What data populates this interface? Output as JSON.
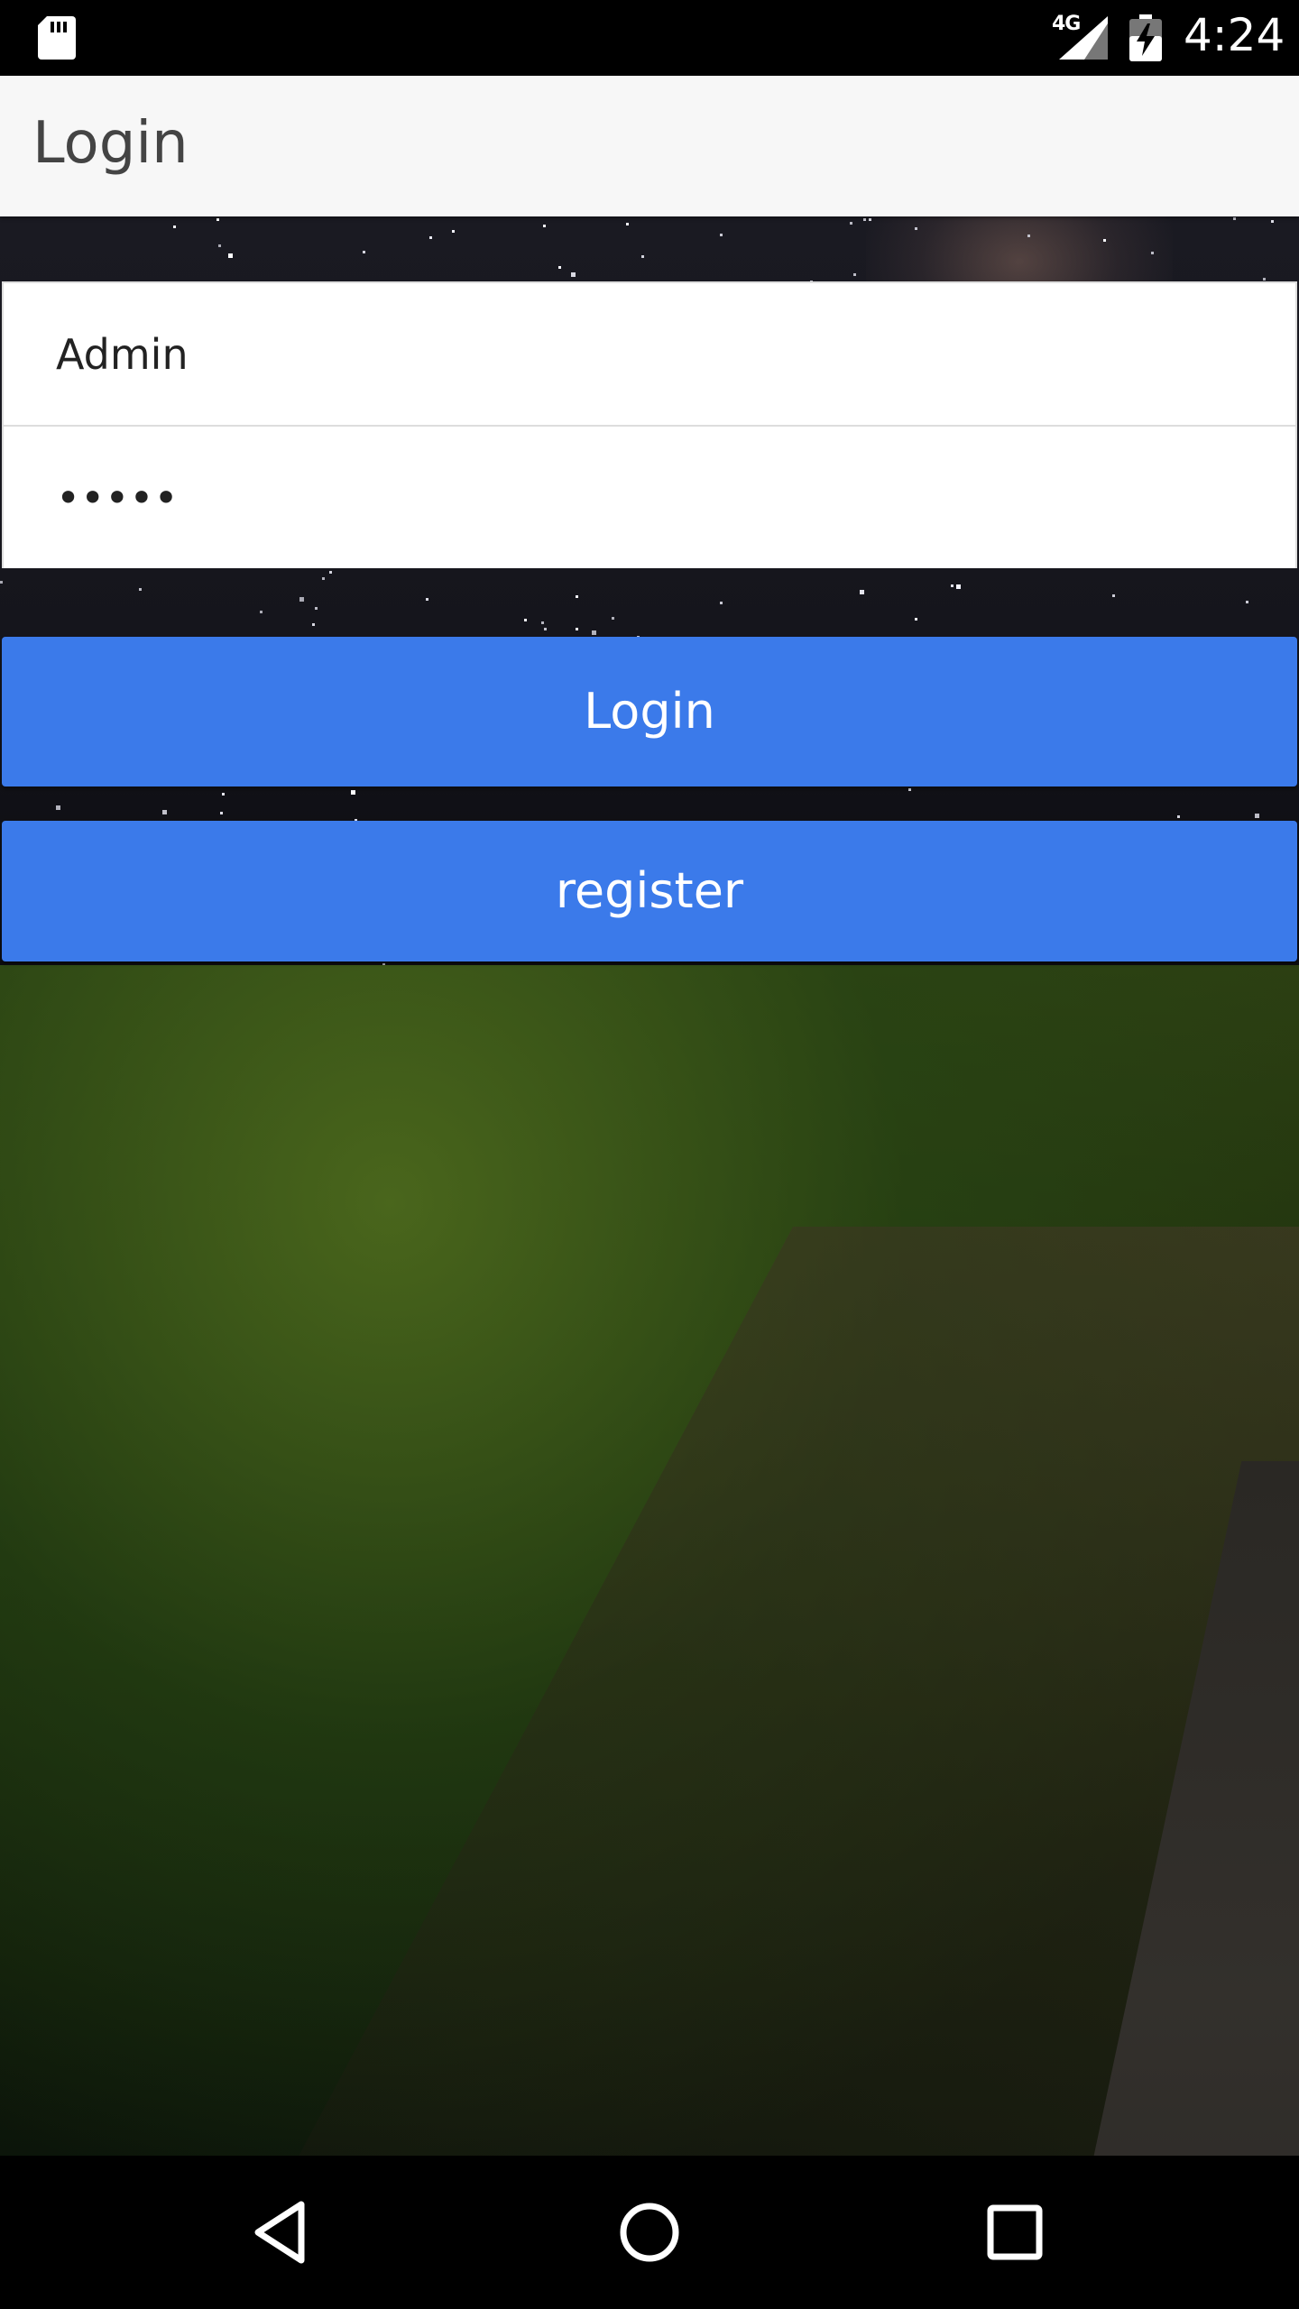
{
  "status_bar": {
    "network": "4G",
    "time": "4:24",
    "icons": [
      "sd-card-icon",
      "signal-icon",
      "battery-charging-icon"
    ]
  },
  "app_bar": {
    "title": "Login"
  },
  "form": {
    "username": {
      "value": "Admin"
    },
    "password": {
      "value": "•••••"
    }
  },
  "buttons": {
    "login_label": "Login",
    "register_label": "register"
  },
  "colors": {
    "app_bar_bg": "#f7f7f7",
    "button_bg": "#3b7aea",
    "button_text": "#ffffff",
    "status_bar_bg": "#000000"
  },
  "nav_bar": {
    "icons": [
      "back-icon",
      "home-icon",
      "recents-icon"
    ]
  }
}
